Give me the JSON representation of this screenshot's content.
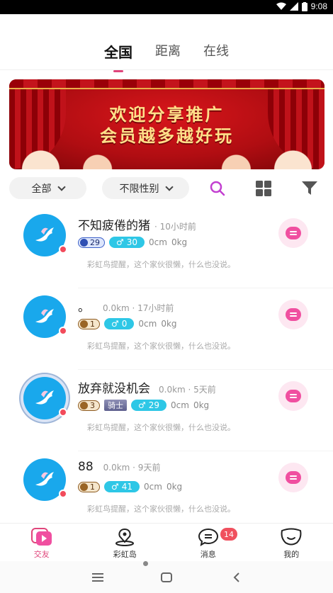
{
  "status_bar": {
    "time": "9:08"
  },
  "tabs": [
    {
      "label": "全国",
      "active": true
    },
    {
      "label": "距离",
      "active": false
    },
    {
      "label": "在线",
      "active": false
    }
  ],
  "banner": {
    "line1": "欢迎分享推广",
    "line2": "会员越多越好玩"
  },
  "filters": {
    "region": "全部",
    "gender": "不限性别"
  },
  "users": [
    {
      "name": "不知疲倦的猪",
      "meta": "· 10小时前",
      "level": "29",
      "level_style": "blue",
      "title_badge": "",
      "gender_count": "30",
      "height": "0cm",
      "weight": "0kg",
      "bio": "彩虹鸟提醒，这个家伙很懒，什么也没说。"
    },
    {
      "name": "。",
      "meta": "0.0km · 17小时前",
      "level": "1",
      "level_style": "brown",
      "title_badge": "",
      "gender_count": "0",
      "height": "0cm",
      "weight": "0kg",
      "bio": "彩虹鸟提醒，这个家伙很懒，什么也没说。"
    },
    {
      "name": "放弃就没机会",
      "meta": "0.0km · 5天前",
      "level": "3",
      "level_style": "brown",
      "title_badge": "骑士",
      "gender_count": "29",
      "height": "0cm",
      "weight": "0kg",
      "bio": "彩虹鸟提醒，这个家伙很懒，什么也没说。"
    },
    {
      "name": "88",
      "meta": "0.0km · 9天前",
      "level": "1",
      "level_style": "brown",
      "title_badge": "",
      "gender_count": "41",
      "height": "0cm",
      "weight": "0kg",
      "bio": "彩虹鸟提醒，这个家伙很懒，什么也没说。"
    }
  ],
  "bottom_nav": [
    {
      "label": "交友",
      "icon": "play-card-icon",
      "active": true
    },
    {
      "label": "彩虹岛",
      "icon": "map-pin-icon",
      "active": false
    },
    {
      "label": "消息",
      "icon": "chat-bubble-icon",
      "active": false,
      "badge": "14"
    },
    {
      "label": "我的",
      "icon": "smile-face-icon",
      "active": false
    }
  ],
  "colors": {
    "accent": "#e0457b",
    "avatar_bg": "#19a8ec",
    "gender_badge": "#2ec7e6",
    "chat_pink": "#f04fa0"
  }
}
